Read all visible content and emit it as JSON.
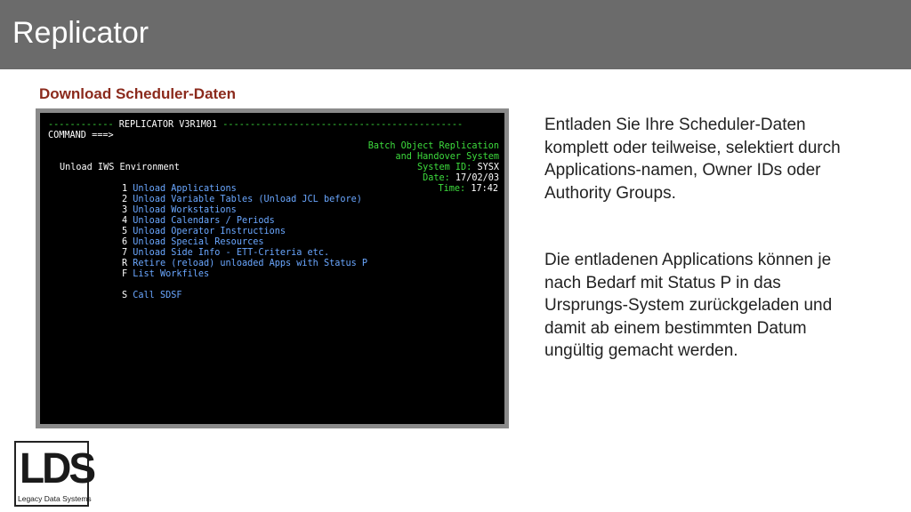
{
  "header": {
    "title": "Replicator"
  },
  "subtitle": "Download Scheduler-Daten",
  "terminal": {
    "header_dashes_left": "------------",
    "header_title": "REPLICATOR V3R1M01",
    "header_dashes_right": "--------------------------------------------",
    "command_label": "COMMAND ===>",
    "product_line1": "Batch Object Replication",
    "product_line2": "and Handover System",
    "system_id_label": "System ID:",
    "system_id_value": "SYSX",
    "date_label": "Date:",
    "date_value": "17/02/03",
    "time_label": "Time:",
    "time_value": "17:42",
    "environment_label": "Unload IWS Environment",
    "menu": [
      {
        "key": "1",
        "label": "Unload Applications"
      },
      {
        "key": "2",
        "label": "Unload Variable Tables (Unload JCL before)"
      },
      {
        "key": "3",
        "label": "Unload Workstations"
      },
      {
        "key": "4",
        "label": "Unload Calendars / Periods"
      },
      {
        "key": "5",
        "label": "Unload Operator Instructions"
      },
      {
        "key": "6",
        "label": "Unload Special Resources"
      },
      {
        "key": "7",
        "label": "Unload Side Info - ETT-Criteria etc."
      },
      {
        "key": "R",
        "label": "Retire (reload) unloaded Apps with Status P"
      },
      {
        "key": "F",
        "label": "List Workfiles"
      },
      {
        "key": "S",
        "label": "Call SDSF"
      }
    ]
  },
  "description": {
    "paragraph1": "Entladen Sie Ihre Scheduler-Daten komplett oder teilweise, selektiert durch Applications-namen, Owner IDs oder Authority Groups.",
    "paragraph2": "Die entladenen Applications können je nach Bedarf mit Status P in das Ursprungs-System zurückgeladen und damit ab einem bestimmten Datum ungültig gemacht werden."
  },
  "logo": {
    "letters": "LDS",
    "tagline": "Legacy Data Systems"
  },
  "colors": {
    "header_bg": "#6b6b6b",
    "subtitle": "#8b2a1c",
    "terminal_bg": "#000000",
    "terminal_green": "#3ddc3d",
    "terminal_blue": "#6aa7ff"
  }
}
